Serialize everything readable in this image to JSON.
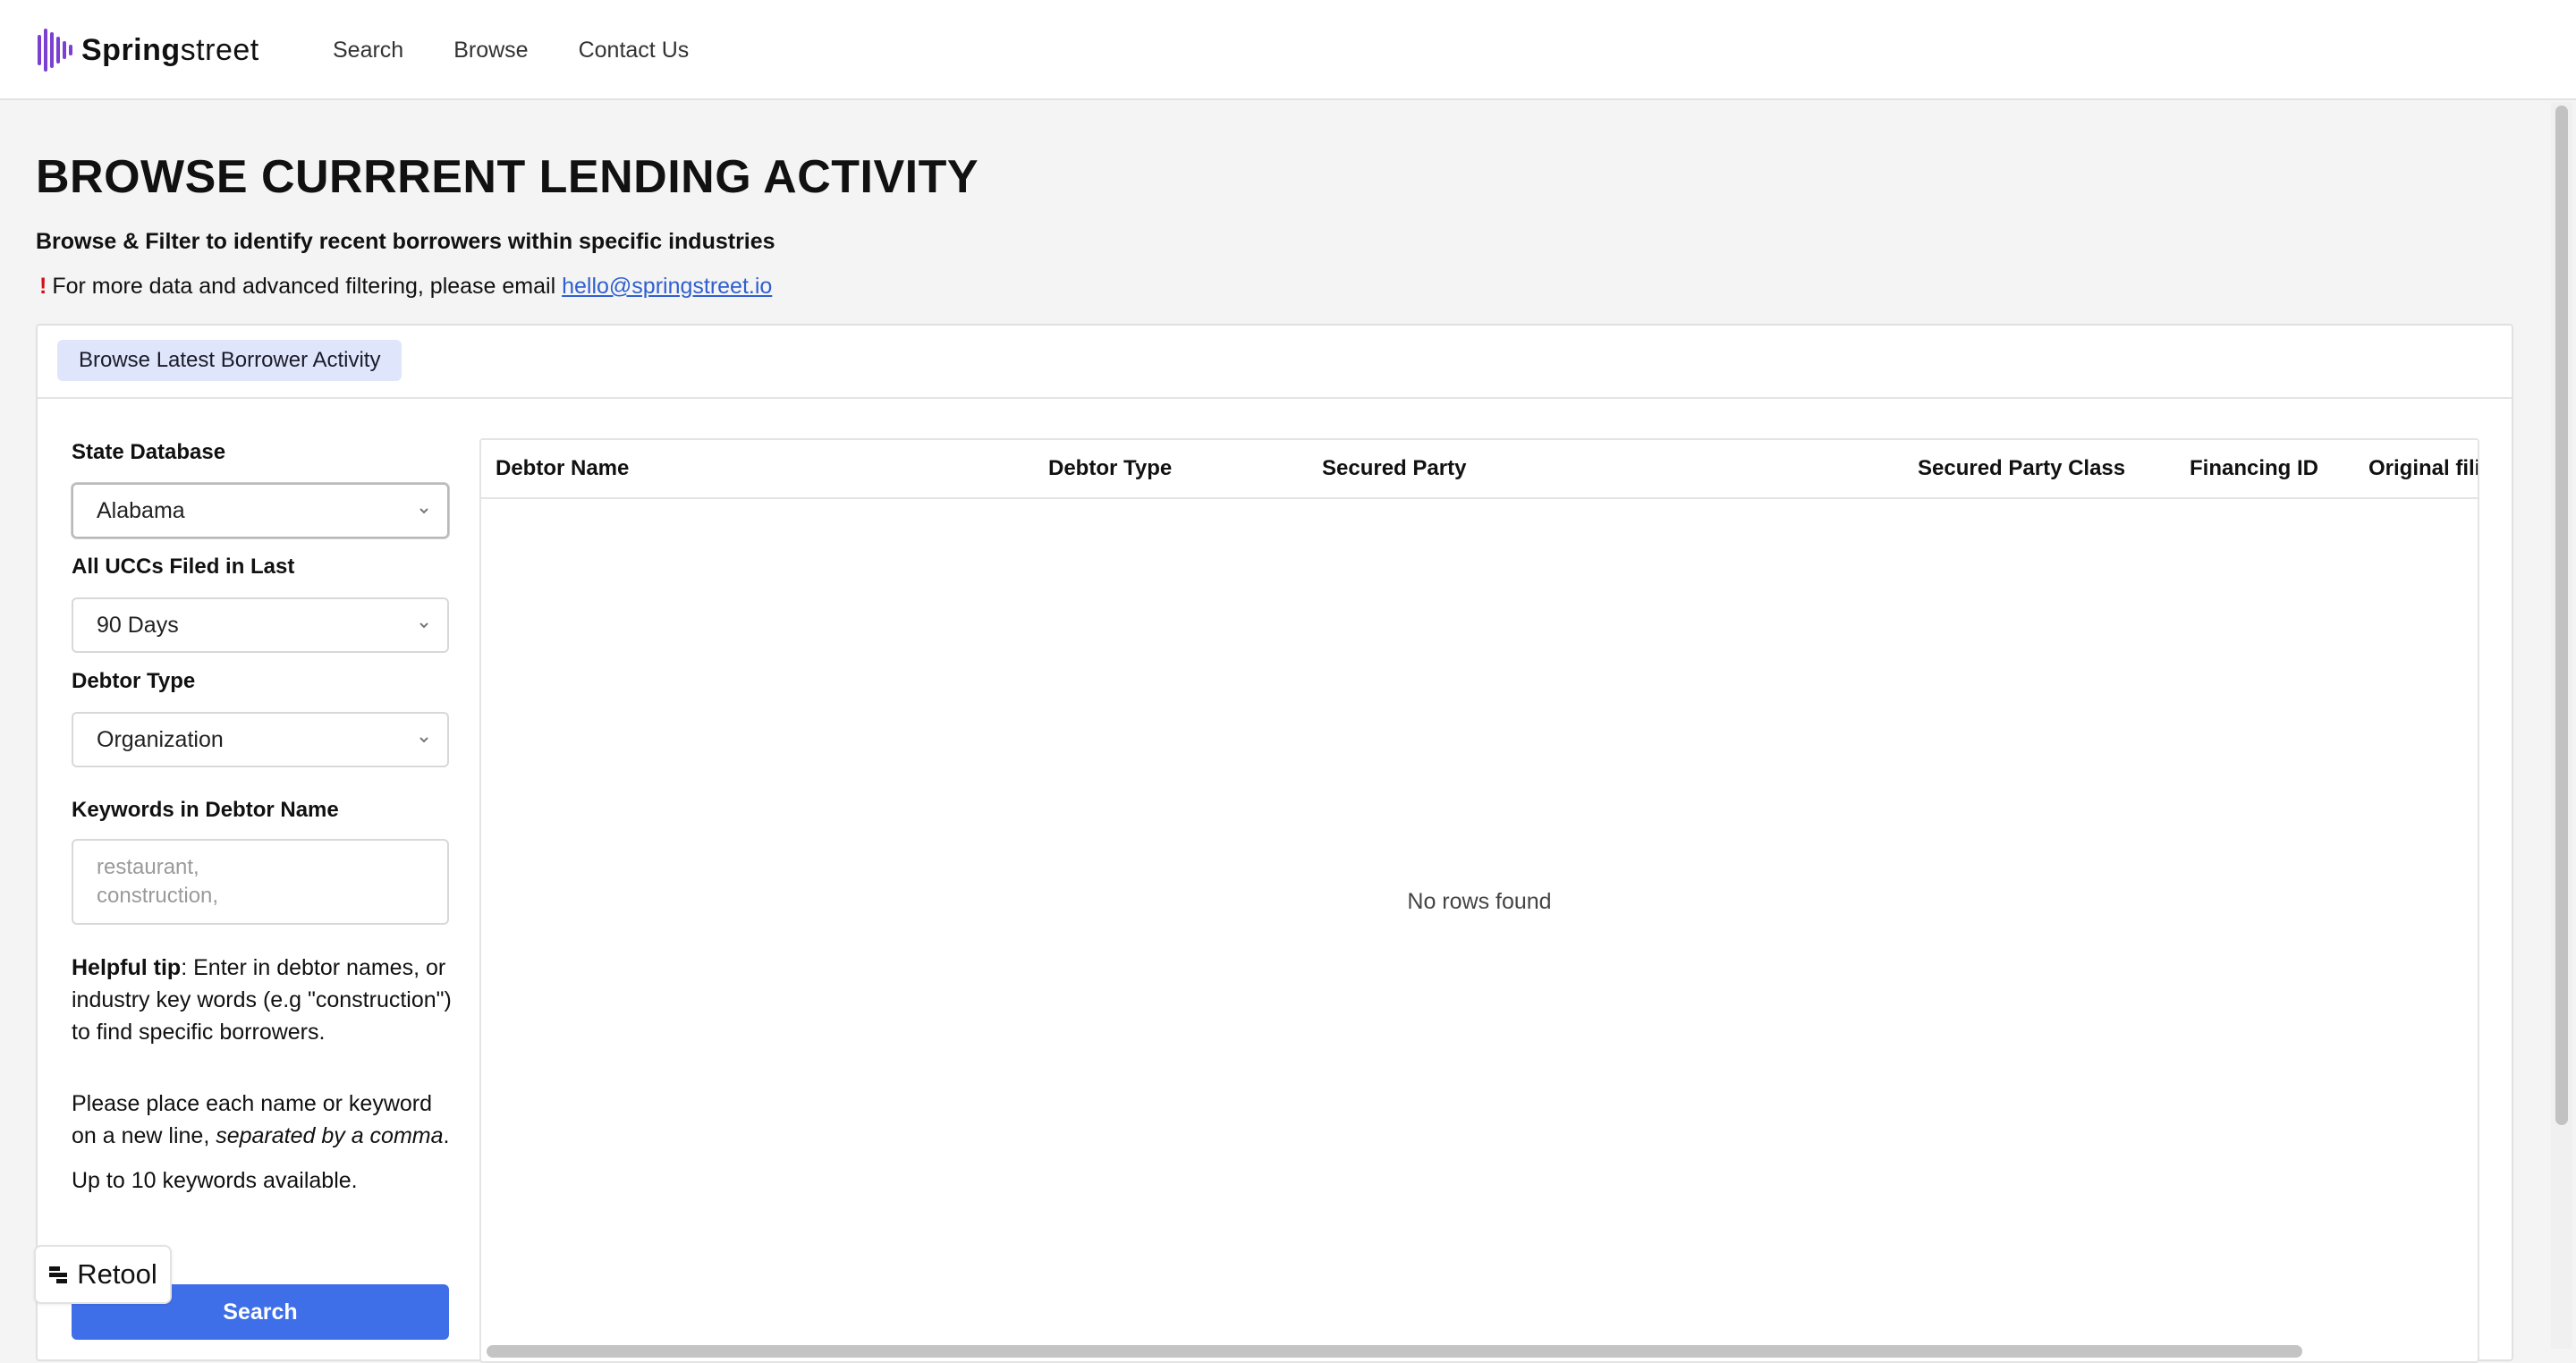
{
  "brand": {
    "name_bold": "Spring",
    "name_rest": "street",
    "logo_color": "#7b3fd1"
  },
  "nav": {
    "items": [
      "Search",
      "Browse",
      "Contact Us"
    ]
  },
  "page": {
    "title": "BROWSE CURRRENT LENDING ACTIVITY",
    "subtitle": "Browse & Filter to identify recent borrowers within specific industries",
    "notice_prefix": "For more data and advanced filtering, please email ",
    "notice_email": "hello@springstreet.io"
  },
  "tabs": [
    {
      "label": "Browse Latest Borrower Activity",
      "active": true
    }
  ],
  "filters": {
    "state_label": "State Database",
    "state_value": "Alabama",
    "filed_label": "All UCCs Filed in Last",
    "filed_value": "90 Days",
    "debtor_type_label": "Debtor Type",
    "debtor_type_value": "Organization",
    "keywords_label": "Keywords in Debtor Name",
    "keywords_placeholder_line1": "restaurant,",
    "keywords_placeholder_line2": "construction,",
    "tip_bold": "Helpful tip",
    "tip_text": ": Enter in debtor names, or industry key words (e.g \"construction\") to find specific borrowers.",
    "place_text": "Please place each name or keyword on a new line, ",
    "place_italic": "separated by a comma",
    "place_end": ".",
    "limit_text": "Up to 10 keywords available.",
    "search_label": "Search"
  },
  "table": {
    "columns": [
      "Debtor Name",
      "Debtor Type",
      "Secured Party",
      "Secured Party Class",
      "Financing ID",
      "Original fili"
    ],
    "rows": [],
    "empty_text": "No rows found"
  },
  "badge": {
    "label": "Retool",
    "icon": "retool-logo-icon"
  },
  "colors": {
    "primary": "#3f6fe8",
    "tab_bg": "#dfe6fb",
    "link": "#2f5fd0",
    "alert": "#d0101a"
  }
}
